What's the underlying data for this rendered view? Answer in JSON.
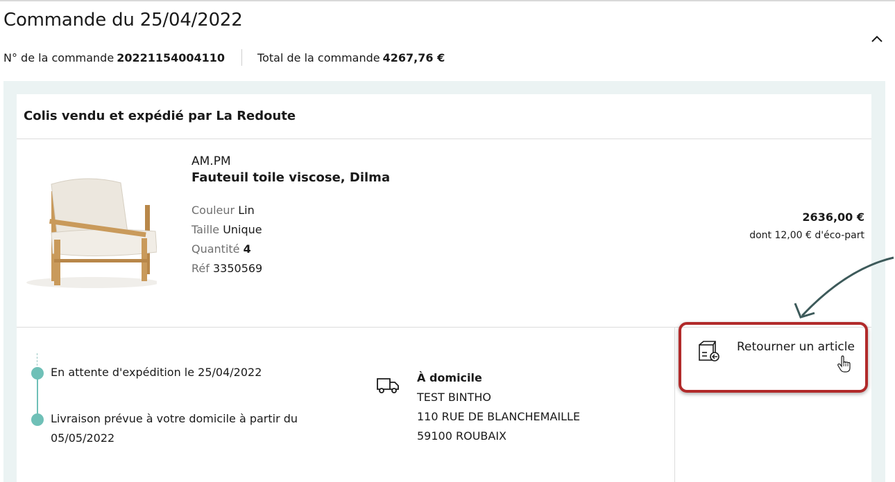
{
  "order": {
    "title": "Commande du 25/04/2022",
    "number_label": "N° de la commande",
    "number": "20221154004110",
    "total_label": "Total de la commande",
    "total": "4267,76 €"
  },
  "parcel": {
    "header": "Colis vendu et expédié par La Redoute"
  },
  "product": {
    "brand": "AM.PM",
    "name": "Fauteuil toile viscose, Dilma",
    "attributes": [
      {
        "key": "Couleur",
        "value": "Lin"
      },
      {
        "key": "Taille",
        "value": "Unique"
      },
      {
        "key": "Quantité",
        "value": "4"
      },
      {
        "key": "Réf",
        "value": "3350569"
      }
    ],
    "price": "2636,00 €",
    "eco_part": "dont 12,00 € d'éco-part"
  },
  "timeline": {
    "step1": "En attente d'expédition le 25/04/2022",
    "step2_line1": "Livraison prévue à votre domicile à partir du",
    "step2_line2": "05/05/2022"
  },
  "delivery": {
    "type": "À domicile",
    "name": "TEST BINTHO",
    "street": "110 RUE DE BLANCHEMAILLE",
    "city": "59100 ROUBAIX"
  },
  "actions": {
    "return_label": "Retourner un article"
  },
  "colors": {
    "accent_teal": "#6fc0b7",
    "highlight_red": "#b12a2a",
    "panel_bg": "#ebf3f3",
    "arrow": "#3d5a5a"
  },
  "icons": {
    "collapse": "chevron-up-icon",
    "delivery": "truck-icon",
    "return": "return-box-icon",
    "cursor": "hand-pointer-icon"
  }
}
